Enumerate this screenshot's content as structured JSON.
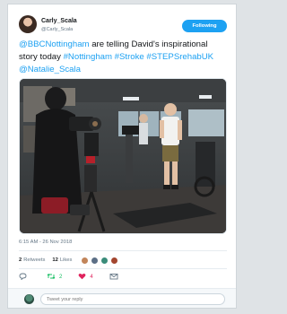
{
  "author": {
    "display_name": "Carly_Scala",
    "handle": "@Carly_Scala",
    "follow_label": "Following"
  },
  "tweet": {
    "parts": [
      {
        "text": "@BBCNottingham",
        "link": true
      },
      {
        "text": " are telling David's inspirational story today ",
        "link": false
      },
      {
        "text": "#Nottingham",
        "link": true
      },
      {
        "text": " ",
        "link": false
      },
      {
        "text": "#Stroke",
        "link": true
      },
      {
        "text": " ",
        "link": false
      },
      {
        "text": "#STEPSrehabUK",
        "link": true
      },
      {
        "text": " ",
        "link": false
      },
      {
        "text": "@Natalie_Scala",
        "link": true
      }
    ],
    "timestamp": "6:15 AM - 26 Nov 2018"
  },
  "stats": {
    "retweets_count": "2",
    "retweets_label": "Retweets",
    "likes_count": "12",
    "likes_label": "Likes"
  },
  "actions": {
    "reply_count": "",
    "retweet_count": "2",
    "like_count": "4"
  },
  "reply": {
    "placeholder": "Tweet your reply"
  },
  "colors": {
    "accent": "#1da1f2",
    "retweet": "#17bf63",
    "like": "#e0245e"
  },
  "icons": {
    "reply": "reply-icon",
    "retweet": "retweet-icon",
    "like": "heart-icon",
    "message": "envelope-icon"
  }
}
